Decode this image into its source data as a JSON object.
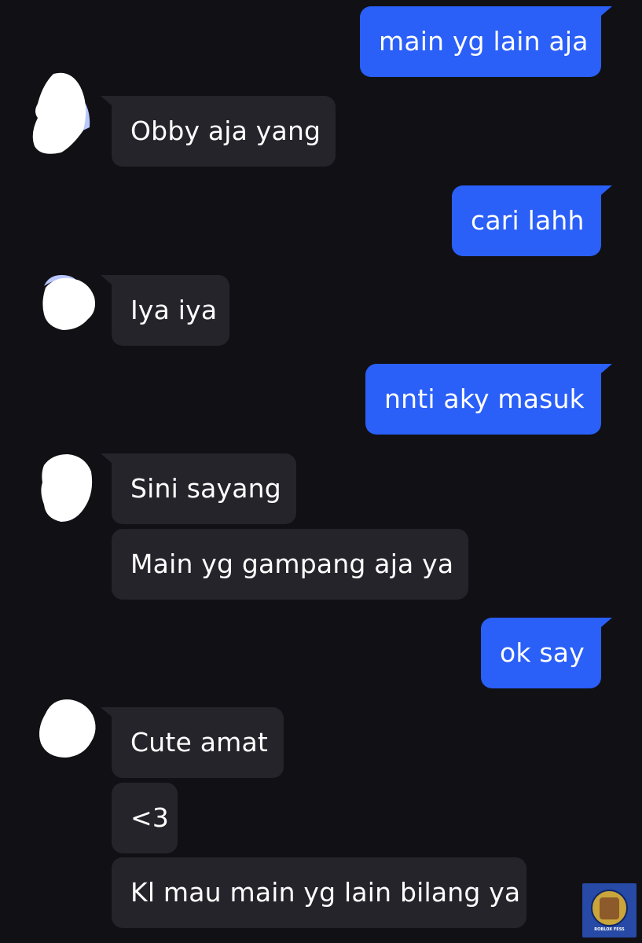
{
  "messages": [
    {
      "direction": "outgoing",
      "text": "main yg lain aja"
    },
    {
      "direction": "incoming",
      "text": "Obby aja yang"
    },
    {
      "direction": "outgoing",
      "text": "cari lahh"
    },
    {
      "direction": "incoming",
      "text": "Iya iya"
    },
    {
      "direction": "outgoing",
      "text": "nnti aky masuk"
    },
    {
      "direction": "incoming",
      "text": "Sini sayang"
    },
    {
      "direction": "incoming",
      "text": "Main yg gampang aja ya"
    },
    {
      "direction": "outgoing",
      "text": "ok say"
    },
    {
      "direction": "incoming",
      "text": "Cute amat"
    },
    {
      "direction": "incoming",
      "text": "<3"
    },
    {
      "direction": "incoming",
      "text": "Kl mau main yg lain bilang ya"
    }
  ],
  "watermark": {
    "text": "ROBLOX FESS",
    "icon": "watermark-logo-icon"
  },
  "colors": {
    "background": "#111014",
    "outgoing_bubble": "#2a5ff8",
    "incoming_bubble": "#25242a",
    "text": "#ffffff"
  }
}
